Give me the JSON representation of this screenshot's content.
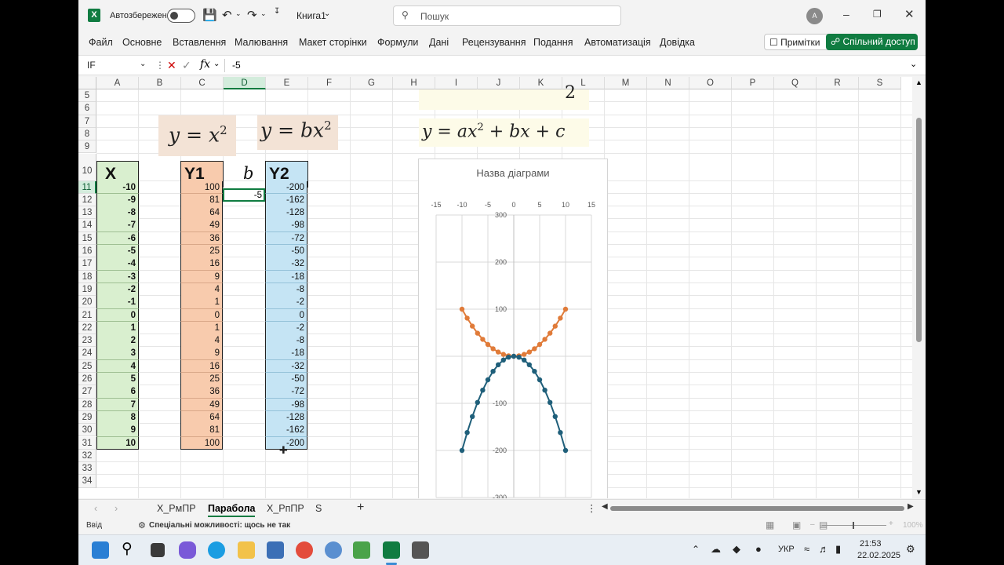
{
  "title_bar": {
    "autosave_label": "Автозбереження",
    "workbook_name": "Книга1",
    "search_placeholder": "Пошук",
    "avatar_initial": "A"
  },
  "menu": [
    "Файл",
    "Основне",
    "Вставлення",
    "Малювання",
    "Макет сторінки",
    "Формули",
    "Дані",
    "Рецензування",
    "Подання",
    "Автоматизація",
    "Довідка"
  ],
  "buttons": {
    "notes": "Примітки",
    "share": "Спільний доступ"
  },
  "formula_bar": {
    "name_box": "IF",
    "fx": "fx",
    "value": "-5"
  },
  "columns": [
    "A",
    "B",
    "C",
    "D",
    "E",
    "F",
    "G",
    "H",
    "I",
    "J",
    "K",
    "L",
    "M",
    "N",
    "O",
    "P",
    "Q",
    "R",
    "S"
  ],
  "rows": [
    "5",
    "6",
    "7",
    "8",
    "9",
    "10",
    "11",
    "12",
    "13",
    "14",
    "15",
    "16",
    "17",
    "18",
    "19",
    "20",
    "21",
    "22",
    "23",
    "24",
    "25",
    "26",
    "27",
    "28",
    "29",
    "30",
    "31",
    "32",
    "33",
    "34"
  ],
  "headers": {
    "x": "X",
    "y1": "Y1",
    "b": "b",
    "y2": "Y2"
  },
  "b_value": "-5",
  "formulas": {
    "f1": "y = x",
    "f1_sup": "2",
    "f2": "y = bx",
    "f2_sup": "2",
    "f3a": "y = ax",
    "f3_sup": "2",
    "f3b": " + bx + c",
    "f3_top_fragment": "2"
  },
  "table": {
    "x": [
      "-10",
      "-9",
      "-8",
      "-7",
      "-6",
      "-5",
      "-4",
      "-3",
      "-2",
      "-1",
      "0",
      "1",
      "2",
      "3",
      "4",
      "5",
      "6",
      "7",
      "8",
      "9",
      "10"
    ],
    "y1": [
      "100",
      "81",
      "64",
      "49",
      "36",
      "25",
      "16",
      "9",
      "4",
      "1",
      "0",
      "1",
      "4",
      "9",
      "16",
      "25",
      "36",
      "49",
      "64",
      "81",
      "100"
    ],
    "y2": [
      "-200",
      "-162",
      "-128",
      "-98",
      "-72",
      "-50",
      "-32",
      "-18",
      "-8",
      "-2",
      "0",
      "-2",
      "-8",
      "-18",
      "-32",
      "-50",
      "-72",
      "-98",
      "-128",
      "-162",
      "-200"
    ]
  },
  "chart_data": {
    "type": "scatter",
    "title": "Назва діаграми",
    "x_ticks": [
      "-15",
      "-10",
      "-5",
      "0",
      "5",
      "10",
      "15"
    ],
    "y_ticks": [
      "300",
      "200",
      "100",
      "0",
      "-100",
      "-200",
      "-300"
    ],
    "xlim": [
      -15,
      15
    ],
    "ylim": [
      -300,
      300
    ],
    "grid": true,
    "series": [
      {
        "color": "#e07b39",
        "x": [
          -10,
          -9,
          -8,
          -7,
          -6,
          -5,
          -4,
          -3,
          -2,
          -1,
          0,
          1,
          2,
          3,
          4,
          5,
          6,
          7,
          8,
          9,
          10
        ],
        "y": [
          100,
          81,
          64,
          49,
          36,
          25,
          16,
          9,
          4,
          1,
          0,
          1,
          4,
          9,
          16,
          25,
          36,
          49,
          64,
          81,
          100
        ]
      },
      {
        "color": "#1f5f7a",
        "x": [
          -10,
          -9,
          -8,
          -7,
          -6,
          -5,
          -4,
          -3,
          -2,
          -1,
          0,
          1,
          2,
          3,
          4,
          5,
          6,
          7,
          8,
          9,
          10
        ],
        "y": [
          -200,
          -162,
          -128,
          -98,
          -72,
          -50,
          -32,
          -18,
          -8,
          -2,
          0,
          -2,
          -8,
          -18,
          -32,
          -50,
          -72,
          -98,
          -128,
          -162,
          -200
        ]
      }
    ]
  },
  "sheet_tabs": [
    "Х_РмПР",
    "Парабола",
    "Х_РпПР",
    "S"
  ],
  "active_tab": "Парабола",
  "status": {
    "mode": "Ввід",
    "accessibility": "Спеціальні можливості: щось не так",
    "zoom": "100%"
  },
  "taskbar": {
    "lang": "УКР",
    "time": "21:53",
    "date": "22.02.2025"
  }
}
